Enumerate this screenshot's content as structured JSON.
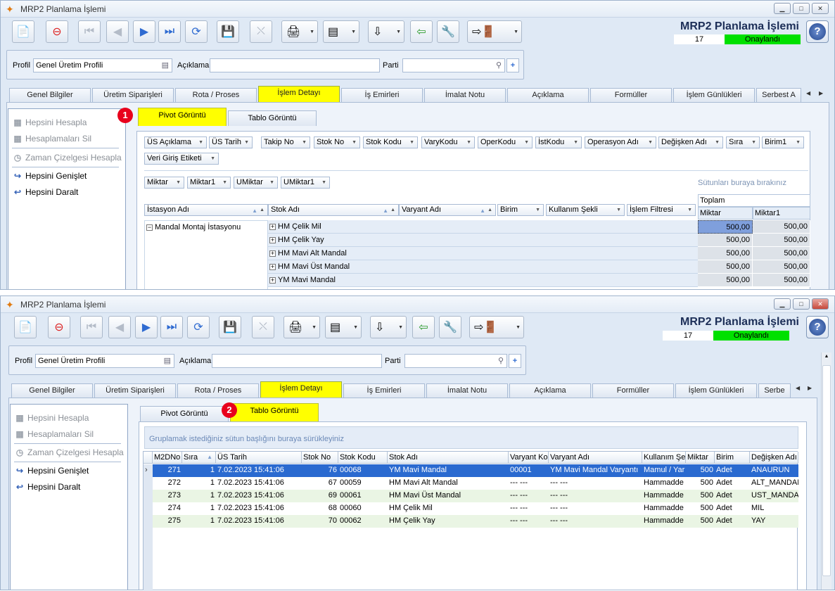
{
  "window": {
    "title": "MRP2 Planlama İşlemi",
    "app_title": "MRP2 Planlama İşlemi",
    "record_no": "17",
    "status": "Onaylandı",
    "status_color": "#00e000",
    "accent": "#ffff00"
  },
  "toolbar": {
    "icons": [
      "new-doc-icon",
      "delete-doc-icon",
      "first-record-icon",
      "prev-record-icon",
      "next-record-icon",
      "last-record-icon",
      "refresh-icon",
      "save-icon",
      "cancel-save-icon",
      "print-icon",
      "pdf-export-icon",
      "import-icon",
      "back-icon",
      "tools-icon",
      "exit-icon"
    ]
  },
  "profile": {
    "profil_label": "Profil",
    "profil_value": "Genel Üretim Profili",
    "aciklama_label": "Açıklama",
    "aciklama_value": "",
    "parti_label": "Parti",
    "parti_value": ""
  },
  "tabs": {
    "top": [
      "Genel Bilgiler",
      "Üretim Siparişleri",
      "Rota / Proses",
      "İşlem Detayı",
      "İş Emirleri",
      "İmalat Notu",
      "Açıklama",
      "Formüller",
      "İşlem Günlükleri"
    ],
    "top_last_1": "Serbest A",
    "top_last_2": "Serbe",
    "active": "İşlem Detayı"
  },
  "left_panel": {
    "hepsini_hesapla": "Hepsini Hesapla",
    "hesaplamalari_sil": "Hesaplamaları Sil",
    "zaman": "Zaman Çizelgesi Hesapla",
    "genislet": "Hepsini Genişlet",
    "daralt": "Hepsini Daralt"
  },
  "subtabs": {
    "pivot": "Pivot Görüntü",
    "tablo": "Tablo Görüntü",
    "badge_1": "1",
    "badge_2": "2"
  },
  "pivot": {
    "filter_fields_row1": [
      "ÜS Açıklama",
      "ÜS Tarih",
      "Takip No",
      "Stok No",
      "Stok Kodu",
      "VaryKodu",
      "OperKodu",
      "İstKodu",
      "Operasyon Adı",
      "Değişken Adı",
      "Sıra",
      "Birim1"
    ],
    "filter_fields_row2": [
      "Veri Giriş Etiketi"
    ],
    "data_fields": [
      "Miktar",
      "Miktar1",
      "UMiktar",
      "UMiktar1"
    ],
    "drop_hint": "Sütunları buraya bırakınız",
    "row_fields": [
      "İstasyon Adı",
      "Stok Adı",
      "Varyant Adı",
      "Birim",
      "Kullanım Şekli",
      "İşlem Filtresi"
    ],
    "total_header": "Toplam",
    "value_headers": [
      "Miktar",
      "Miktar1"
    ],
    "station": "Mandal Montaj İstasyonu",
    "rows": [
      {
        "stok": "HM Çelik Mil",
        "miktar": "500,00",
        "miktar1": "500,00"
      },
      {
        "stok": "HM Çelik Yay",
        "miktar": "500,00",
        "miktar1": "500,00"
      },
      {
        "stok": "HM Mavi Alt Mandal",
        "miktar": "500,00",
        "miktar1": "500,00"
      },
      {
        "stok": "HM Mavi Üst Mandal",
        "miktar": "500,00",
        "miktar1": "500,00"
      },
      {
        "stok": "YM Mavi Mandal",
        "miktar": "500,00",
        "miktar1": "500,00"
      }
    ]
  },
  "table": {
    "group_hint": "Gruplamak istediğiniz sütun başlığını buraya sürükleyiniz",
    "headers": [
      "M2DNo",
      "Sıra",
      "ÜS Tarih",
      "Stok No",
      "Stok Kodu",
      "Stok Adı",
      "Varyant Ko",
      "Varyant Adı",
      "Kullanım Şek",
      "Miktar",
      "Birim",
      "Değişken Adı"
    ],
    "rows": [
      [
        "271",
        "1",
        "7.02.2023 15:41:06",
        "76",
        "00068",
        "YM Mavi Mandal",
        "00001",
        "YM Mavi Mandal Varyantı",
        "Mamul / Yar",
        "500",
        "Adet",
        "ANAURUN"
      ],
      [
        "272",
        "1",
        "7.02.2023 15:41:06",
        "67",
        "00059",
        "HM Mavi Alt Mandal",
        "--- ---",
        "--- ---",
        "Hammadde",
        "500",
        "Adet",
        "ALT_MANDAL"
      ],
      [
        "273",
        "1",
        "7.02.2023 15:41:06",
        "69",
        "00061",
        "HM Mavi Üst Mandal",
        "--- ---",
        "--- ---",
        "Hammadde",
        "500",
        "Adet",
        "UST_MANDAL"
      ],
      [
        "274",
        "1",
        "7.02.2023 15:41:06",
        "68",
        "00060",
        "HM Çelik Mil",
        "--- ---",
        "--- ---",
        "Hammadde",
        "500",
        "Adet",
        "MIL"
      ],
      [
        "275",
        "1",
        "7.02.2023 15:41:06",
        "70",
        "00062",
        "HM Çelik Yay",
        "--- ---",
        "--- ---",
        "Hammadde",
        "500",
        "Adet",
        "YAY"
      ]
    ]
  }
}
